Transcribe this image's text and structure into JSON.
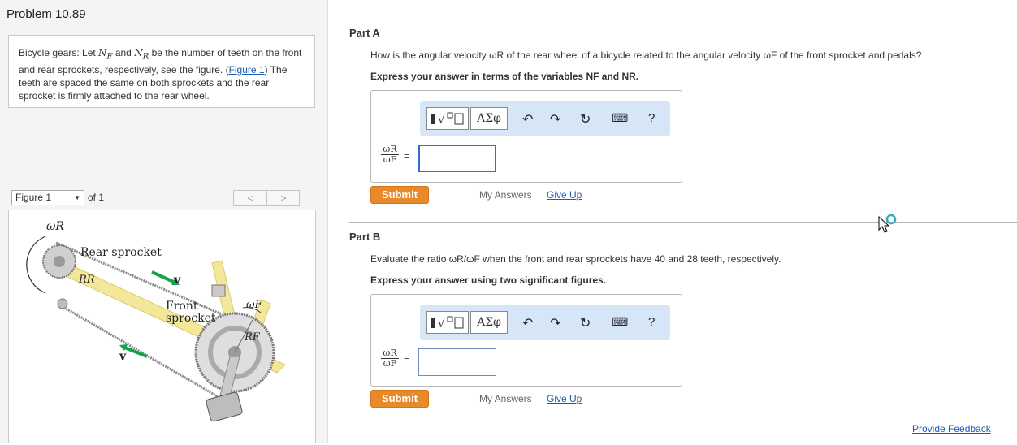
{
  "problem": {
    "title": "Problem 10.89",
    "text_intro": "Bicycle gears: Let ",
    "sym_nf": "N",
    "sym_nf_sub": "F",
    "text_and": " and ",
    "sym_nr": "N",
    "sym_nr_sub": "R",
    "text_mid": " be the number of teeth on the front and rear sprockets, respectively, see the figure. (",
    "figure_link": "Figure 1",
    "text_end": ") The teeth are spaced the same on both sprockets and the rear sprocket is firmly attached to the rear wheel."
  },
  "figure_nav": {
    "selected": "Figure 1",
    "of_label": "of 1",
    "prev": "<",
    "next": ">"
  },
  "figure": {
    "omega_r": "ωR",
    "rear_sprocket": "Rear sprocket",
    "r_r": "RR",
    "v_top": "v",
    "front_line1": "Front",
    "front_line2": "sprocket",
    "omega_f": "ωF",
    "r_f": "RF",
    "v_bottom": "v",
    "colors": {
      "arrow": "#17a34a",
      "chain": "#8a8a8a",
      "frame": "#f3e79a",
      "crank": "#c9c9c9"
    }
  },
  "part_a": {
    "label": "Part A",
    "question": "How is the angular velocity ωR of the rear wheel of a bicycle related to the angular velocity ωF of the front sprocket and pedals?",
    "instruction": "Express your answer in terms of the variables NF and NR.",
    "fraction_num": "ωR",
    "fraction_den": "ωF",
    "equals": "=",
    "answer_value": "",
    "submit": "Submit",
    "my_answers": "My Answers",
    "give_up": "Give Up"
  },
  "part_b": {
    "label": "Part B",
    "question": "Evaluate the ratio ωR/ωF when the front and rear sprockets have 40 and 28 teeth, respectively.",
    "instruction": "Express your answer using two significant figures.",
    "fraction_num": "ωR",
    "fraction_den": "ωF",
    "equals": "=",
    "answer_value": "",
    "submit": "Submit",
    "my_answers": "My Answers",
    "give_up": "Give Up"
  },
  "toolbar": {
    "greek": "ΑΣφ",
    "undo": "↶",
    "redo": "↷",
    "reset": "↻",
    "keyboard": "⌨",
    "help": "?"
  },
  "footer": {
    "provide_feedback": "Provide Feedback"
  }
}
